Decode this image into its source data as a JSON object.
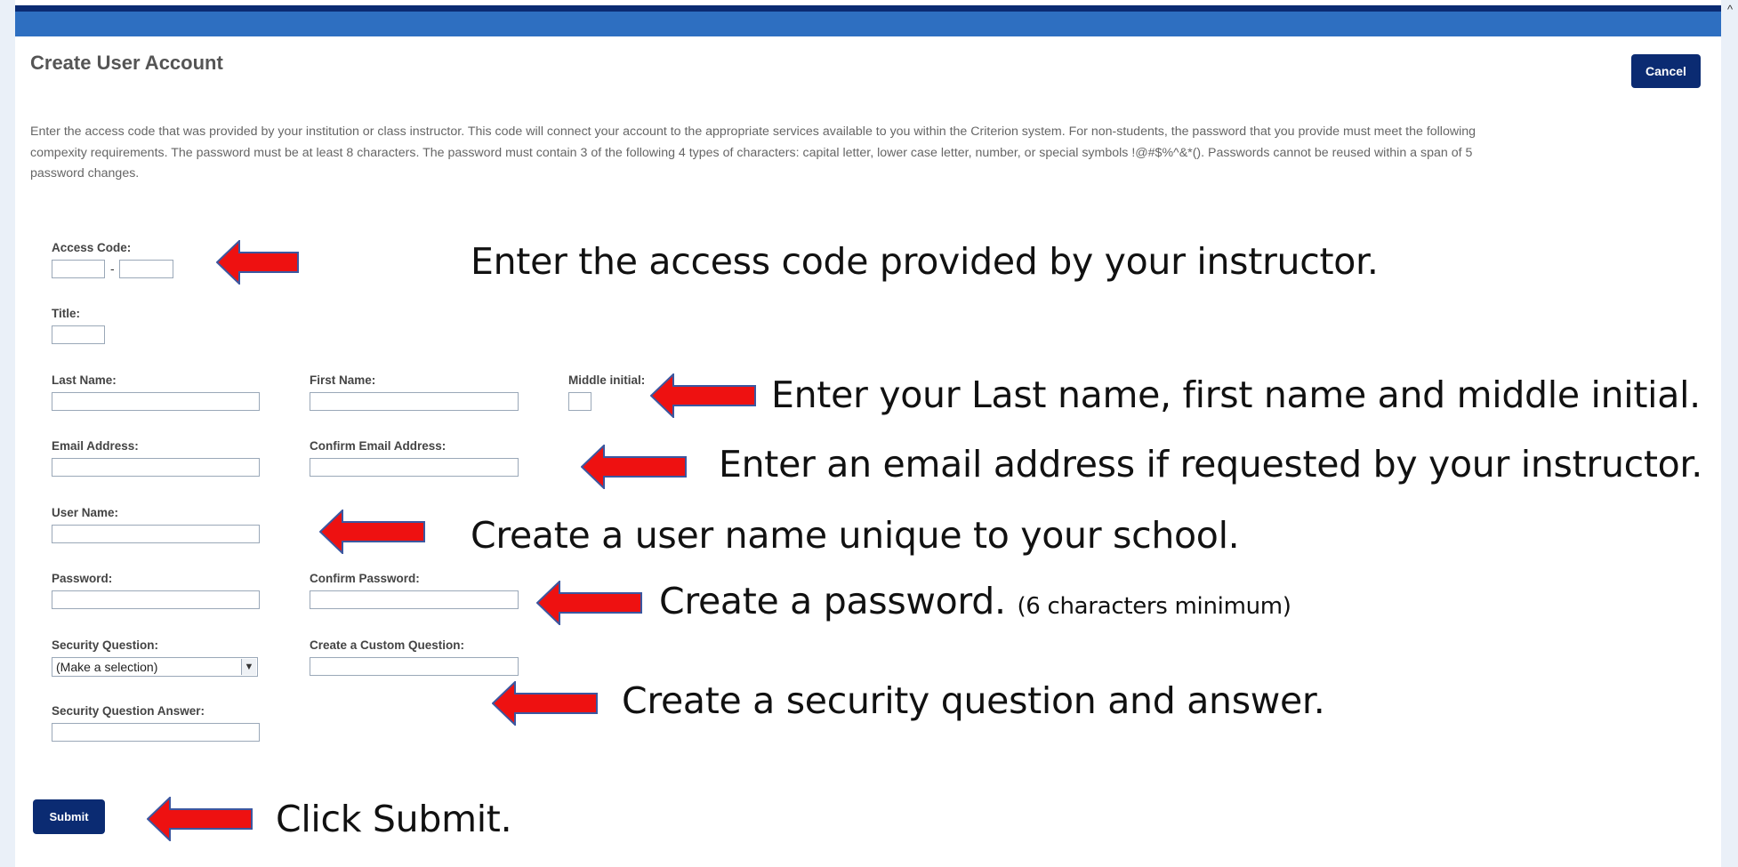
{
  "page": {
    "title": "Create User Account",
    "cancel_label": "Cancel",
    "submit_label": "Submit",
    "intro": "Enter the access code that was provided by your institution or class instructor. This code will connect your account to the appropriate services available to you within the Criterion system. For non-students, the password that you provide must meet the following compexity requirements. The password must be at least 8 characters. The password must contain 3 of the following 4 types of characters: capital letter, lower case letter, number, or special symbols !@#$%^&*(). Passwords cannot be reused within a span of 5 password changes."
  },
  "form": {
    "access_code_label": "Access Code:",
    "access_code_separator": "-",
    "title_label": "Title:",
    "last_name_label": "Last Name:",
    "first_name_label": "First Name:",
    "middle_initial_label": "Middle initial:",
    "email_label": "Email Address:",
    "confirm_email_label": "Confirm Email Address:",
    "user_name_label": "User Name:",
    "password_label": "Password:",
    "confirm_password_label": "Confirm Password:",
    "security_question_label": "Security Question:",
    "security_question_value": "(Make a selection)",
    "custom_question_label": "Create a Custom Question:",
    "security_answer_label": "Security Question Answer:"
  },
  "annotations": {
    "access_code": "Enter the access code provided by your instructor.",
    "names": "Enter your Last name, first name and middle initial.",
    "email": "Enter an email address if requested by your instructor.",
    "user_name": "Create a user name unique to your school.",
    "password": "Create a password.",
    "password_note": "(6 characters minimum)",
    "security": "Create a security question and answer.",
    "submit": "Click Submit."
  },
  "colors": {
    "header_bar": "#2e6fc1",
    "header_bar_dark": "#0b2b72",
    "button": "#0b2b72",
    "arrow": "#ee1111",
    "arrow_outline": "#3b57a0"
  },
  "icons": {
    "scroll_up": "chevron-up-icon",
    "select_caret": "chevron-down-icon",
    "annotation_arrow": "left-arrow-icon"
  }
}
